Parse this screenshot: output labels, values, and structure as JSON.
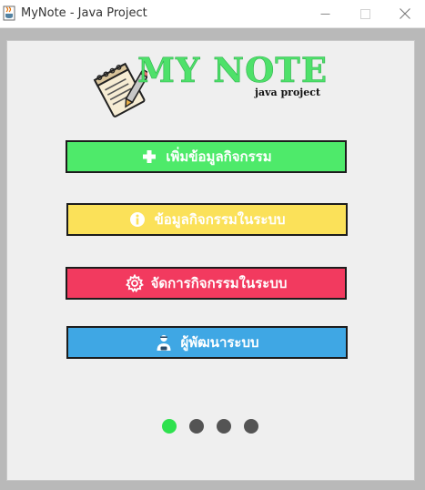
{
  "window": {
    "title": "MyNote - Java Project",
    "icon": "java-cup-icon"
  },
  "logo": {
    "title": "MY NOTE",
    "subtitle": "java project",
    "icon": "notepad-pen-icon"
  },
  "menu": {
    "add_activity": {
      "label": "เพิ่มข้อมูลกิจกรรม",
      "icon": "plus-icon",
      "color": "#4eea6a"
    },
    "activity_info": {
      "label": "ข้อมูลกิจกรรมในระบบ",
      "icon": "info-icon",
      "color": "#fbe159"
    },
    "manage_activity": {
      "label": "จัดการกิจกรรมในระบบ",
      "icon": "gear-icon",
      "color": "#f23a5f"
    },
    "developers": {
      "label": "ผู้พัฒนาระบบ",
      "icon": "developer-icon",
      "color": "#3fa7e4"
    }
  },
  "pagination": {
    "total": 4,
    "active": 1,
    "active_color": "#2ee14e",
    "inactive_color": "#545454"
  }
}
